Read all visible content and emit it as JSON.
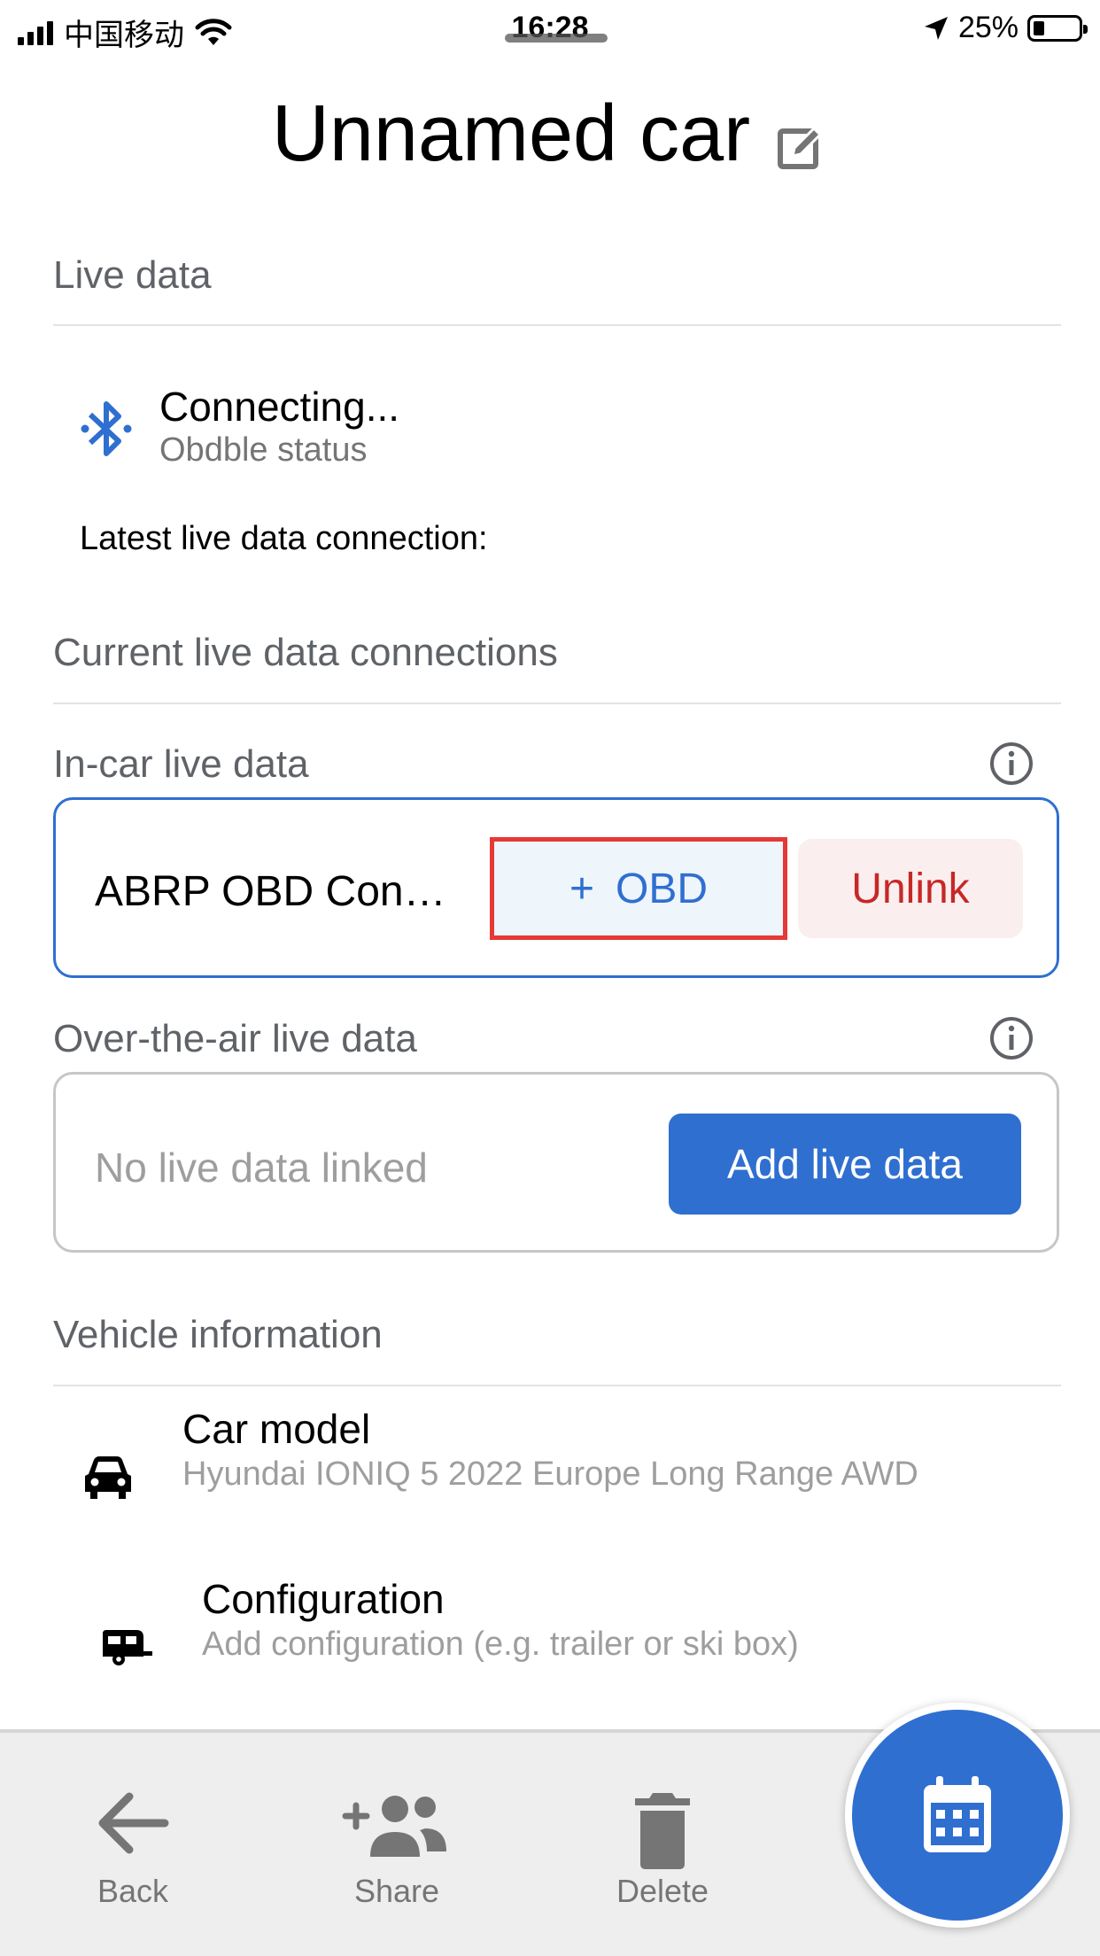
{
  "status_bar": {
    "carrier": "中国移动",
    "time": "16:28",
    "battery": "25%",
    "battery_level": 0.25
  },
  "title": "Unnamed car",
  "live_data": {
    "header": "Live data",
    "status_primary": "Connecting...",
    "status_secondary": "Obdble status",
    "latest_connection_label": "Latest live data connection:"
  },
  "current_connections": {
    "header": "Current live data connections",
    "in_car": {
      "label": "In-car live data",
      "device_name": "ABRP OBD Connect",
      "obd_button": "OBD",
      "obd_button_prefix": "+",
      "unlink_button": "Unlink"
    },
    "ota": {
      "label": "Over-the-air live data",
      "empty_text": "No live data linked",
      "add_button": "Add live data"
    }
  },
  "vehicle_information": {
    "header": "Vehicle information",
    "car_model": {
      "label": "Car model",
      "value": "Hyundai IONIQ 5 2022 Europe Long Range AWD"
    },
    "configuration": {
      "label": "Configuration",
      "value": "Add configuration (e.g. trailer or ski box)"
    }
  },
  "bottom_nav": {
    "back": "Back",
    "share": "Share",
    "delete": "Delete"
  },
  "colors": {
    "primary": "#2f6fd0",
    "danger": "#c62828",
    "highlight_border": "#e53935"
  },
  "icons": [
    "signal-icon",
    "wifi-icon",
    "location-icon",
    "battery-icon",
    "edit-icon",
    "bluetooth-icon",
    "info-icon",
    "car-icon",
    "caravan-icon",
    "back-arrow-icon",
    "add-group-icon",
    "trash-icon",
    "calendar-icon"
  ]
}
